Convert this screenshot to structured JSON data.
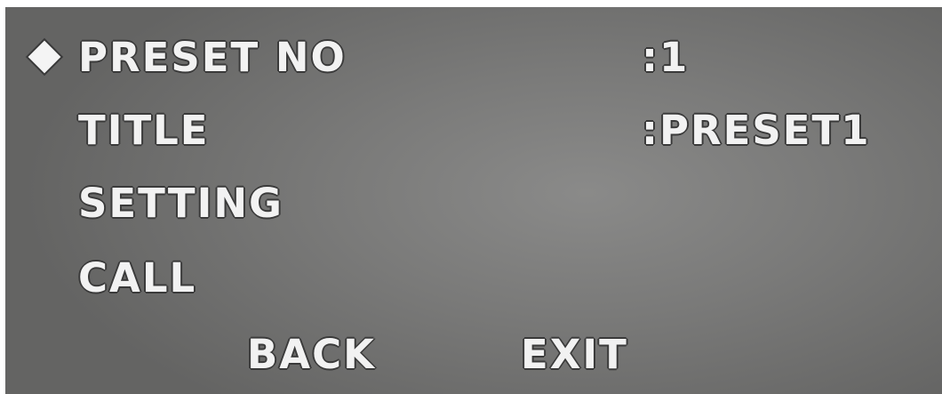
{
  "menu": {
    "cursor_icon": "diamond-cursor-icon",
    "items": [
      {
        "label": "PRESET NO",
        "value": ":1"
      },
      {
        "label": "TITLE",
        "value": ":PRESET1"
      },
      {
        "label": "SETTING"
      },
      {
        "label": "CALL"
      }
    ],
    "back_label": "BACK",
    "exit_label": "EXIT"
  },
  "colors": {
    "text": "#f2f2f2",
    "background": "#7a7a79"
  }
}
